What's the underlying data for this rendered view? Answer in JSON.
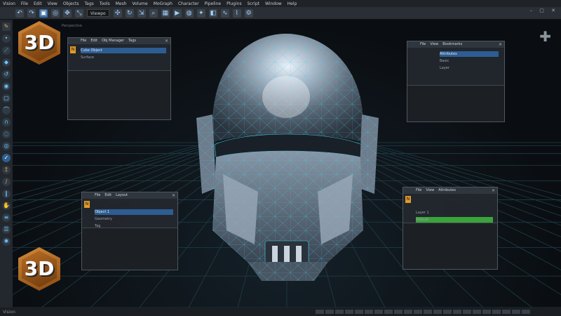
{
  "menubar": {
    "items": [
      "Vision",
      "File",
      "Edit",
      "View",
      "Objects",
      "Tags",
      "Tools",
      "Mesh",
      "Volume",
      "MoGraph",
      "Character",
      "Pipeline",
      "Plugins",
      "Script",
      "Window",
      "Help"
    ]
  },
  "toolbar": {
    "field_value": "Viewpo",
    "tool_icons": [
      "move-icon",
      "rotate-icon",
      "scale-icon",
      "zoom-icon",
      "grid-icon",
      "render-icon"
    ]
  },
  "viewport": {
    "title": "Perspective"
  },
  "badges": {
    "top_text": "3D",
    "bottom_text": "3D",
    "color": "#c07a2e"
  },
  "panels": {
    "top_left": {
      "tabs": [
        "File",
        "Edit",
        "Obj Manager",
        "Tags"
      ],
      "rows": [
        "Cube Object",
        "Surface"
      ]
    },
    "top_right": {
      "tabs": [
        "File",
        "View",
        "Bookmarks"
      ],
      "rows": [
        "Attributes",
        "Basic",
        "Layer"
      ]
    },
    "bottom_left": {
      "tabs": [
        "File",
        "Edit",
        "Layout"
      ],
      "rows": [
        "Object 1",
        "Geometry",
        "Tag"
      ]
    },
    "bottom_right": {
      "tabs": [
        "File",
        "View",
        "Attributes"
      ],
      "rows": [
        "Layer 1",
        "Default"
      ]
    }
  },
  "status": {
    "text": "Vision"
  },
  "colors": {
    "accent": "#3b6ea5",
    "helmet": "#7f8fa1",
    "wire": "#2ec8e6",
    "grid": "#1f3e47"
  }
}
